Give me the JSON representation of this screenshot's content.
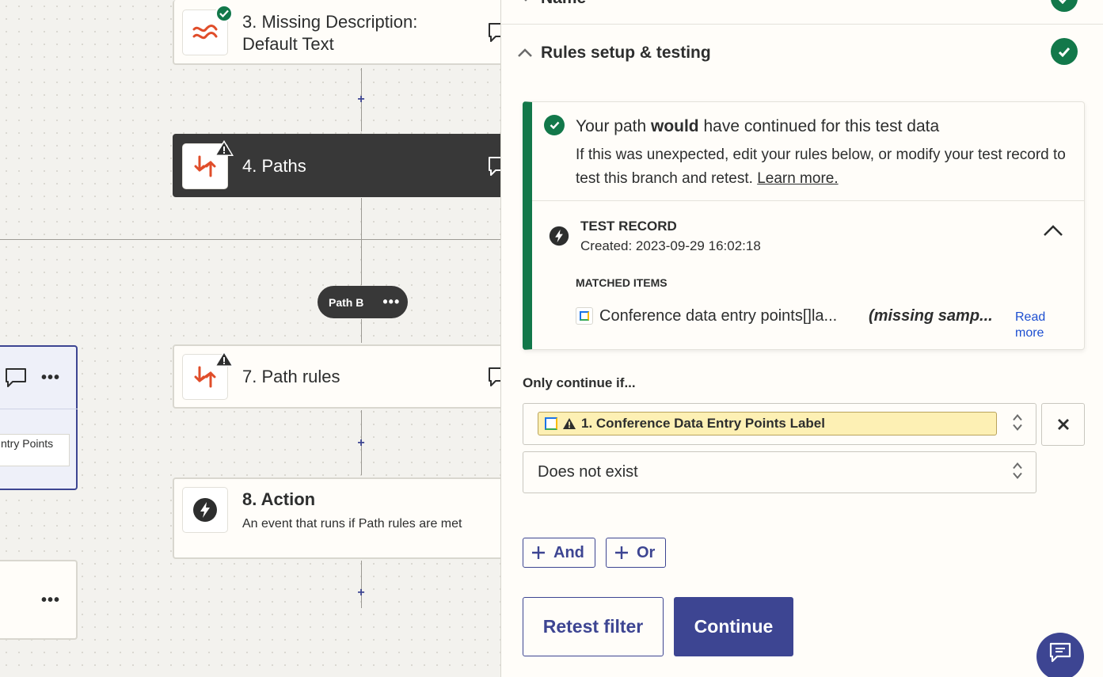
{
  "canvas": {
    "step3": {
      "title_line1": "3. Missing Description:",
      "title_line2": "Default Text"
    },
    "step4": {
      "title": "4. Paths"
    },
    "path_pill": {
      "label": "Path B",
      "menu": "•••"
    },
    "step7": {
      "title": "7. Path rules"
    },
    "step8": {
      "title": "8. Action",
      "description": "An event that runs if Path rules are met"
    },
    "left_card": {
      "field_text": "ntry Points",
      "menu": "•••"
    },
    "left_card2": {
      "menu": "•••"
    },
    "plus": "+"
  },
  "panel": {
    "name_section": {
      "label": "Name"
    },
    "rules_section": {
      "label": "Rules setup & testing"
    },
    "result": {
      "headline_pre": "Your path ",
      "headline_bold": "would",
      "headline_post": " have continued for this test data",
      "body": "If this was unexpected, edit your rules below, or modify your test record to test this branch and retest. ",
      "learn_more": "Learn more."
    },
    "test_record": {
      "title": "TEST RECORD",
      "created": "Created: 2023-09-29 16:02:18",
      "matched_label": "MATCHED ITEMS",
      "item_name": "Conference data entry points[]la...",
      "item_value": "(missing samp...",
      "read_more": "Read more"
    },
    "rule": {
      "only_continue": "Only continue if...",
      "field": "1. Conference Data Entry Points Label",
      "condition": "Does not exist"
    },
    "buttons": {
      "and": "And",
      "or": "Or",
      "retest": "Retest filter",
      "continue": "Continue"
    }
  },
  "colors": {
    "brand": "#3d4592",
    "success": "#12784a",
    "zap_orange": "#e04d2a",
    "warning_chip": "#fdf0b4"
  }
}
